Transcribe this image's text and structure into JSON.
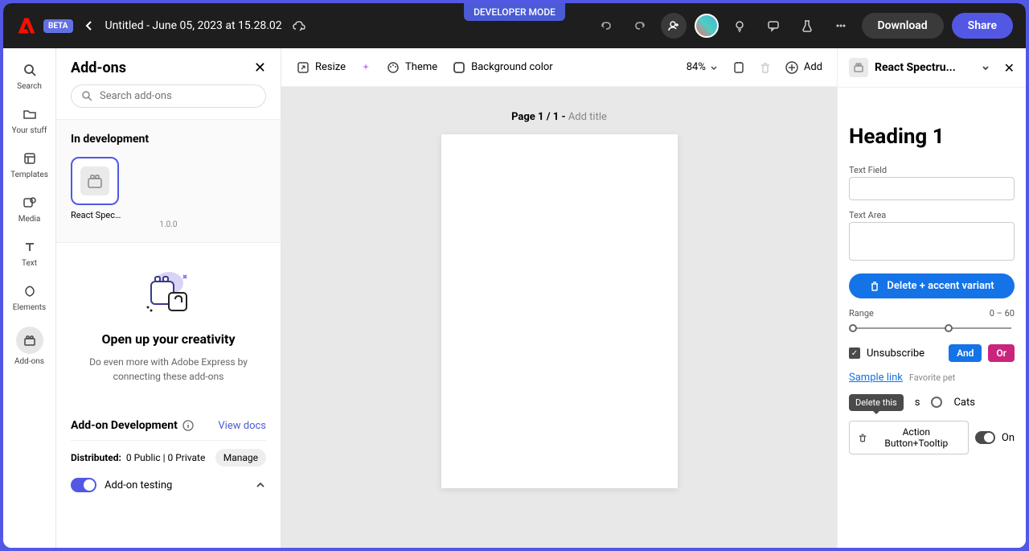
{
  "header": {
    "dev_mode": "DEVELOPER MODE",
    "beta": "BETA",
    "title": "Untitled - June 05, 2023 at 15.28.02",
    "download": "Download",
    "share": "Share"
  },
  "rail": {
    "items": [
      {
        "label": "Search"
      },
      {
        "label": "Your stuff"
      },
      {
        "label": "Templates"
      },
      {
        "label": "Media"
      },
      {
        "label": "Text"
      },
      {
        "label": "Elements"
      },
      {
        "label": "Add-ons"
      }
    ]
  },
  "panel": {
    "title": "Add-ons",
    "search_placeholder": "Search add-ons",
    "in_dev": "In development",
    "addon": {
      "name": "React Spectr...",
      "version": "1.0.0"
    },
    "creativity": {
      "title": "Open up your creativity",
      "desc": "Do even more with Adobe Express by connecting these add-ons"
    },
    "dev": {
      "title": "Add-on Development",
      "view_docs": "View docs",
      "dist_label": "Distributed:",
      "dist_value": "0 Public | 0 Private",
      "manage": "Manage",
      "testing": "Add-on testing"
    }
  },
  "toolbar": {
    "resize": "Resize",
    "theme": "Theme",
    "bg": "Background color",
    "zoom": "84%",
    "add": "Add"
  },
  "canvas": {
    "page_prefix": "Page 1 / 1 - ",
    "page_title": "Add title"
  },
  "rp": {
    "title": "React Spectru...",
    "heading": "Heading 1",
    "text_field_label": "Text Field",
    "text_area_label": "Text Area",
    "delete_btn": "Delete + accent variant",
    "range_label": "Range",
    "range_val": "0 – 60",
    "unsubscribe": "Unsubscribe",
    "and": "And",
    "or": "Or",
    "sample_link": "Sample link",
    "favorite": "Favorite pet",
    "tooltip": "Delete this",
    "radio_s": "s",
    "cats": "Cats",
    "action_btn": "Action Button+Tooltip",
    "on": "On"
  }
}
